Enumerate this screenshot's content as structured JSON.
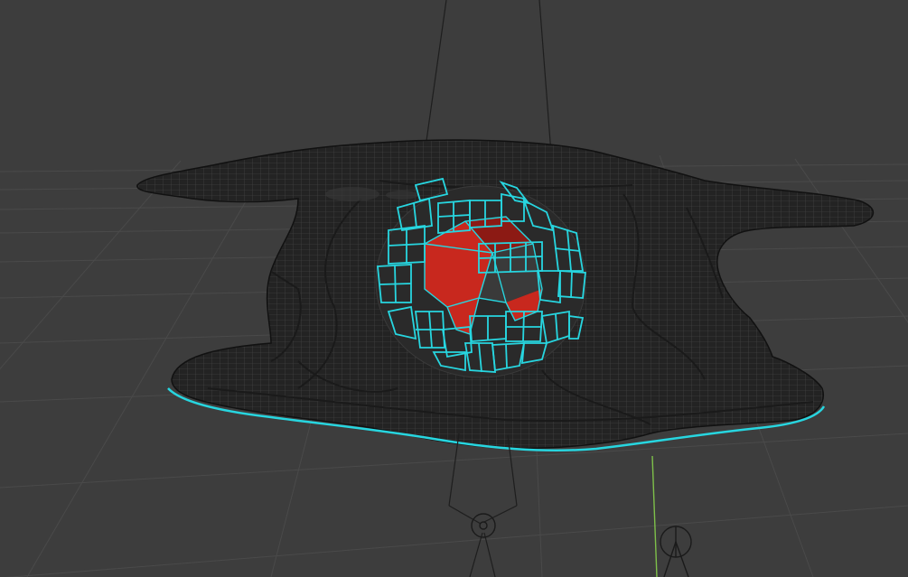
{
  "viewport": {
    "background_color": "#3d3d3d",
    "grid_color": "#4a4a4a",
    "y_axis_color": "#7ec04a",
    "rig_line_color": "#1e1e1e",
    "mesh_fill_color": "#252525",
    "mesh_wire_color": "#4a4a4a",
    "selection_color": "#27d6e0",
    "face_highlight_color": "#c8281e"
  },
  "scene": {
    "objects": [
      {
        "kind": "mesh",
        "icon": "base-mesh-icon",
        "selected": false
      },
      {
        "kind": "sphere-fragments",
        "icon": "selected-sphere-icon",
        "selected": true
      },
      {
        "kind": "bone",
        "icon": "armature-bone-icon",
        "selected": false
      },
      {
        "kind": "empty",
        "icon": "empty-object-icon",
        "selected": false
      }
    ]
  }
}
